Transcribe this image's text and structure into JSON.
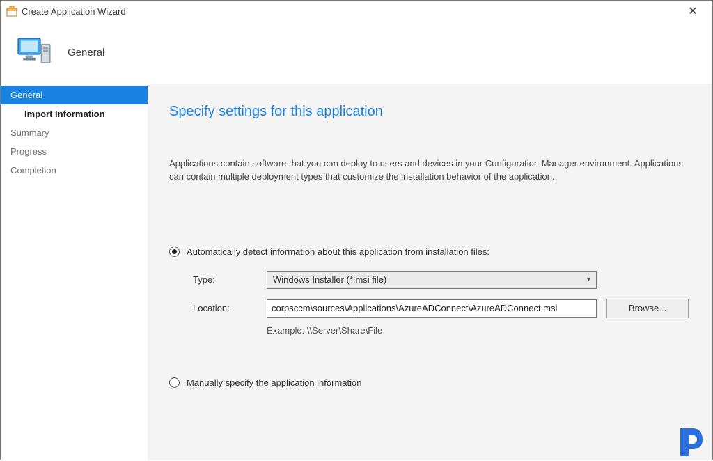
{
  "window": {
    "title": "Create Application Wizard"
  },
  "header": {
    "page_title": "General"
  },
  "sidebar": {
    "items": [
      {
        "label": "General",
        "active": true
      },
      {
        "label": "Import Information",
        "sub": true
      },
      {
        "label": "Summary"
      },
      {
        "label": "Progress"
      },
      {
        "label": "Completion"
      }
    ]
  },
  "content": {
    "heading": "Specify settings for this application",
    "description": "Applications contain software that you can deploy to users and devices in your Configuration Manager environment. Applications can contain multiple deployment types that customize the installation behavior of the application.",
    "option_auto": "Automatically detect information about this application from installation files:",
    "option_manual": "Manually specify the application information",
    "type_label": "Type:",
    "type_value": "Windows Installer (*.msi file)",
    "location_label": "Location:",
    "location_value": "corpsccm\\sources\\Applications\\AzureADConnect\\AzureADConnect.msi",
    "browse_label": "Browse...",
    "example_label": "Example: \\\\Server\\Share\\File"
  }
}
